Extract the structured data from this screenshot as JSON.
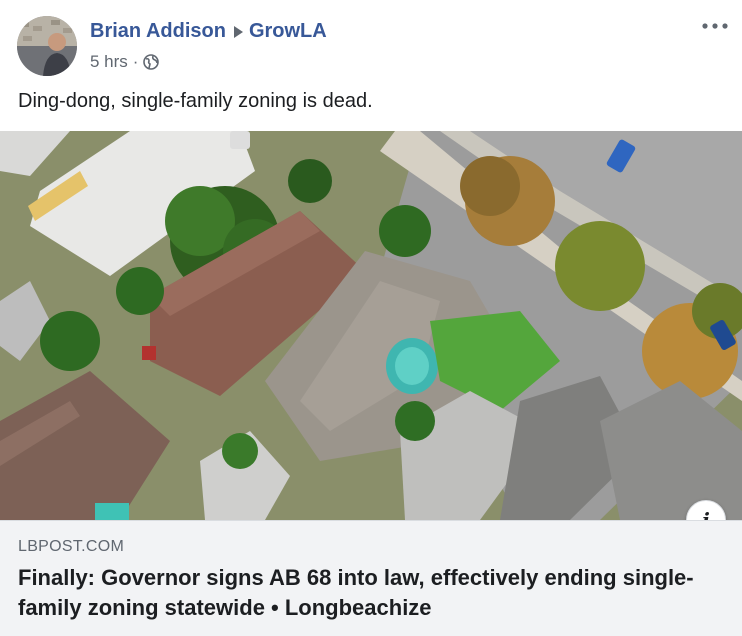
{
  "post": {
    "author": "Brian Addison",
    "group": "GrowLA",
    "timestamp": "5 hrs",
    "separator": "·",
    "audience_icon": "globe-icon",
    "text": "Ding-dong, single-family zoning is dead."
  },
  "link": {
    "domain": "LBPOST.COM",
    "headline": "Finally: Governor signs AB 68 into law, effectively ending single-family zoning statewide • Longbeachize",
    "info_label": "i"
  },
  "colors": {
    "name_blue": "#385898",
    "meta_gray": "#606770",
    "text_dark": "#1c1e21",
    "footer_bg": "#f2f3f5"
  }
}
